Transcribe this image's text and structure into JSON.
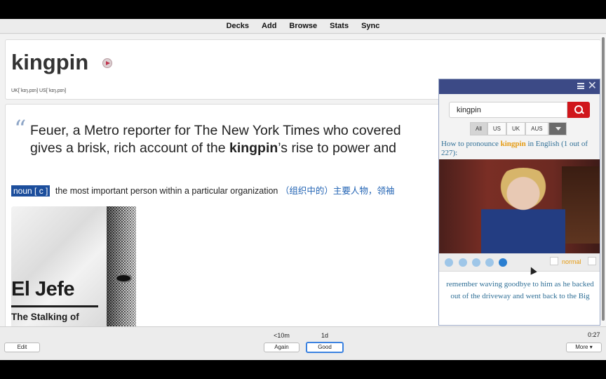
{
  "nav": {
    "items": [
      "Decks",
      "Add",
      "Browse",
      "Stats",
      "Sync"
    ]
  },
  "card": {
    "word": "kingpin",
    "phonetic": "UK[ˈkɪŋ.pɪn] US[ˈkɪŋ.pɪn]",
    "quote_mark": "“",
    "quote_line1": "Feuer, a Metro reporter for The New York Times who covered",
    "quote_line2_pre": "gives a brisk, rich account of the ",
    "quote_line2_bold": "kingpin",
    "quote_line2_post": "’s rise to power and",
    "pos": "noun [ c ]",
    "definition": " the most important person within a particular organization ",
    "definition_zh": "（组织中的）主要人物，领袖",
    "poster_title": "El Jefe",
    "poster_subtitle": "The Stalking of"
  },
  "popup": {
    "search_value": "kingpin",
    "filters": [
      "All",
      "US",
      "UK",
      "AUS"
    ],
    "active_filter": "All",
    "how_pre": "How to pronounce ",
    "how_word": "kingpin",
    "how_post": " in English (1 out of 227):",
    "speed": "normal",
    "caption": "remember waving goodbye to him as he backed out of the driveway and went back to the Big"
  },
  "bottom": {
    "edit": "Edit",
    "again_time": "<10m",
    "again": "Again",
    "good_time": "1d",
    "good": "Good",
    "timer": "0:27",
    "more": "More ▾"
  },
  "colors": {
    "accent": "#1c4e9c",
    "popup_header": "#3c4a86",
    "search_btn": "#d0161b",
    "highlight": "#e59b12"
  },
  "icons": [
    "play-icon",
    "menu-icon",
    "close-icon",
    "search-icon",
    "dropdown-icon",
    "prev-icon",
    "replay-icon",
    "repeat-icon",
    "pause-icon",
    "next-icon"
  ]
}
